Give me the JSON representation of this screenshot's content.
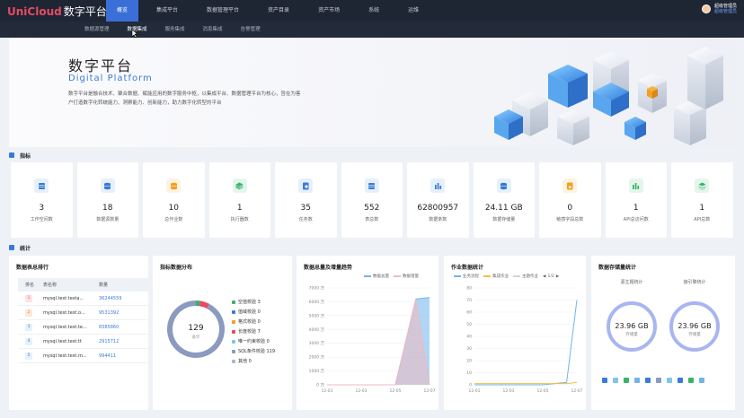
{
  "brand": {
    "name": "UniCloud",
    "product": "数字平台"
  },
  "topnav": [
    "概览",
    "集成平台",
    "数据管理平台",
    "资产目录",
    "资产市场",
    "系统",
    "运维"
  ],
  "user": {
    "name": "超级管理员",
    "role": "超级管理员"
  },
  "subnav": [
    "数据源管理",
    "数据集成",
    "服务集成",
    "消息集成",
    "告警管理"
  ],
  "hero": {
    "title": "数字平台",
    "subtitle": "Digital Platform",
    "desc": "数字平台是融合技术、聚合数据、赋能应用的数字服务中枢，以集成平台、数据管理平台为核心，旨在为客户打造数字化转统能力、洞察能力、创新能力，助力数字化转型的平台"
  },
  "sections": {
    "metrics": "指标",
    "stats": "统计"
  },
  "metrics": [
    {
      "value": "3",
      "label": "工作空间数",
      "color": "#3a7bd5",
      "bg": "#e6f0fc",
      "icon": "table-icon"
    },
    {
      "value": "18",
      "label": "数据源数量",
      "color": "#3a7bd5",
      "bg": "#e6f0fc",
      "icon": "database-icon"
    },
    {
      "value": "10",
      "label": "总作业数",
      "color": "#f0a020",
      "bg": "#fdf3e0",
      "icon": "database-icon"
    },
    {
      "value": "1",
      "label": "执行器数",
      "color": "#3ab26b",
      "bg": "#e4f6ec",
      "icon": "cube-icon"
    },
    {
      "value": "35",
      "label": "任务数",
      "color": "#3a7bd5",
      "bg": "#e6f0fc",
      "icon": "search-doc-icon"
    },
    {
      "value": "552",
      "label": "表总数",
      "color": "#3a7bd5",
      "bg": "#e6f0fc",
      "icon": "table-icon"
    },
    {
      "value": "62800957",
      "label": "数据条数",
      "color": "#3a7bd5",
      "bg": "#e6f0fc",
      "icon": "bar-icon"
    },
    {
      "value": "24.11 GB",
      "label": "数据存储量",
      "color": "#3a7bd5",
      "bg": "#e6f0fc",
      "icon": "database-icon"
    },
    {
      "value": "0",
      "label": "敏感字段总数",
      "color": "#f0a020",
      "bg": "#fdf3e0",
      "icon": "lock-doc-icon"
    },
    {
      "value": "1",
      "label": "API总访问数",
      "color": "#3ab26b",
      "bg": "#e4f6ec",
      "icon": "bar-icon"
    },
    {
      "value": "1",
      "label": "API总数",
      "color": "#3ab26b",
      "bg": "#e4f6ec",
      "icon": "layers-icon"
    }
  ],
  "rank": {
    "title": "数据表总排行",
    "headers": [
      "排名",
      "表名称",
      "数量"
    ],
    "rows": [
      {
        "rank": "1",
        "name": "mysql.test.testa...",
        "count": "36244559"
      },
      {
        "rank": "2",
        "name": "mysql.test.test.o...",
        "count": "9531392"
      },
      {
        "rank": "3",
        "name": "mysql.test.test.te...",
        "count": "8385860"
      },
      {
        "rank": "4",
        "name": "mysql.test.test.tt",
        "count": "2915712"
      },
      {
        "rank": "5",
        "name": "mysql.test.test.m...",
        "count": "994411"
      }
    ]
  },
  "quality": {
    "title": "指标数据分布",
    "total": "129",
    "total_label": "总计",
    "items": [
      {
        "label": "空值校验",
        "value": "3",
        "color": "#3ab26b"
      },
      {
        "label": "值域校验",
        "value": "0",
        "color": "#3a7bd5"
      },
      {
        "label": "格式校验",
        "value": "0",
        "color": "#f0a020"
      },
      {
        "label": "长度校验",
        "value": "7",
        "color": "#e64b63"
      },
      {
        "label": "唯一约束校验",
        "value": "0",
        "color": "#7cc7e8"
      },
      {
        "label": "SQL条件校验",
        "value": "119",
        "color": "#8a9bbf"
      },
      {
        "label": "其他",
        "value": "0",
        "color": "#b0b7c3"
      }
    ]
  },
  "chart_data": [
    {
      "type": "area",
      "title": "数据总量及增量趋势",
      "x": [
        "12-01",
        "12-03",
        "12-05",
        "12-07"
      ],
      "ylim": [
        0,
        7000
      ],
      "yticks": [
        "0 万",
        "1000 万",
        "2000 万",
        "3000 万",
        "4000 万",
        "5000 万",
        "6000 万",
        "7000 万"
      ],
      "series": [
        {
          "name": "数据总量",
          "color": "#6fb4ec",
          "points": [
            [
              0,
              0
            ],
            [
              1,
              0
            ],
            [
              2,
              0
            ],
            [
              2.6,
              6200
            ],
            [
              3,
              6300
            ]
          ]
        },
        {
          "name": "数据增量",
          "color": "#f0b9bd",
          "points": [
            [
              0,
              0
            ],
            [
              1,
              0
            ],
            [
              2,
              0
            ],
            [
              2.6,
              6200
            ],
            [
              3,
              0
            ]
          ]
        }
      ]
    },
    {
      "type": "line",
      "title": "作业数据统计",
      "x": [
        "12-01",
        "12-03",
        "12-05",
        "12-07"
      ],
      "ylim": [
        0,
        80
      ],
      "yticks": [
        "0",
        "10",
        "20",
        "30",
        "40",
        "50",
        "60",
        "70",
        "80"
      ],
      "legend": [
        "业务流程",
        "集成作业",
        "主题作业"
      ],
      "pager": "1/2",
      "series": [
        {
          "name": "业务流程",
          "color": "#6fb4ec",
          "points": [
            [
              0,
              0
            ],
            [
              1,
              0
            ],
            [
              2,
              0
            ],
            [
              2.7,
              2
            ],
            [
              3,
              70
            ]
          ]
        },
        {
          "name": "集成作业",
          "color": "#f0c040",
          "points": [
            [
              0,
              1
            ],
            [
              1,
              1
            ],
            [
              2,
              1
            ],
            [
              2.7,
              1
            ],
            [
              3,
              2
            ]
          ]
        }
      ]
    }
  ],
  "storage": {
    "title": "数据存储量统计",
    "gauges": [
      {
        "caption": "源主题统计",
        "value": "23.96 GB",
        "label": "存储量"
      },
      {
        "caption": "接引擎统计",
        "value": "23.96 GB",
        "label": "存储量"
      }
    ],
    "dots": [
      "#3a7bd5",
      "#7cc7e8",
      "#3ab26b",
      "#6fb4ec",
      "#3a7bd5",
      "#8a9bbf",
      "#7cc7e8",
      "#3a7bd5",
      "#3ab26b",
      "#6fb4ec"
    ]
  }
}
